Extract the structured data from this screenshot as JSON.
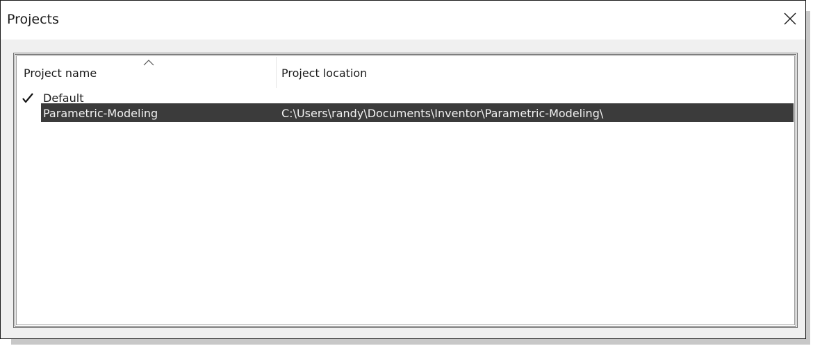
{
  "window": {
    "title": "Projects",
    "close_icon": "close-icon"
  },
  "list": {
    "columns": [
      {
        "label": "Project name",
        "sorted": "ascending"
      },
      {
        "label": "Project location"
      }
    ],
    "rows": [
      {
        "name": "Default",
        "location": "",
        "active": true,
        "selected": false
      },
      {
        "name": "Parametric-Modeling",
        "location": "C:\\Users\\randy\\Documents\\Inventor\\Parametric-Modeling\\",
        "active": false,
        "selected": true
      }
    ]
  },
  "colors": {
    "selection": "#3b3b3b",
    "dialog_bg": "#f0f0f0",
    "shadow": "#c8c8c8"
  }
}
